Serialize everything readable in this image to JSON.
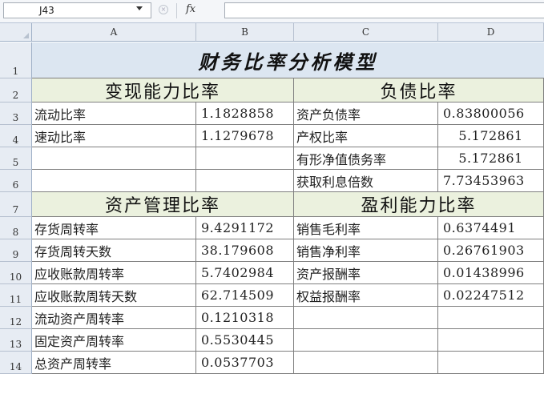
{
  "formula_bar": {
    "cell_ref": "J43",
    "fx": "fx",
    "cancel": "×"
  },
  "columns": [
    "A",
    "B",
    "C",
    "D"
  ],
  "rows": [
    "1",
    "2",
    "3",
    "4",
    "5",
    "6",
    "7",
    "8",
    "9",
    "10",
    "11",
    "12",
    "13",
    "14"
  ],
  "title": "财务比率分析模型",
  "sections": {
    "liquidity": "变现能力比率",
    "debt": "负债比率",
    "asset_mgmt": "资产管理比率",
    "profit": "盈利能力比率"
  },
  "liquidity_rows": [
    {
      "label": "流动比率",
      "value": "1.1828858"
    },
    {
      "label": "速动比率",
      "value": "1.1279678"
    }
  ],
  "debt_rows": [
    {
      "label": "资产负债率",
      "value": "0.83800056"
    },
    {
      "label": "产权比率",
      "value": "5.172861"
    },
    {
      "label": "有形净值债务率",
      "value": "5.172861"
    },
    {
      "label": "获取利息倍数",
      "value": "7.73453963"
    }
  ],
  "asset_rows": [
    {
      "label": "存货周转率",
      "value": "9.4291172"
    },
    {
      "label": "存货周转天数",
      "value": "38.179608"
    },
    {
      "label": "应收账款周转率",
      "value": "5.7402984"
    },
    {
      "label": "应收账款周转天数",
      "value": "62.714509"
    },
    {
      "label": "流动资产周转率",
      "value": "0.1210318"
    },
    {
      "label": "固定资产周转率",
      "value": "0.5530445"
    },
    {
      "label": "总资产周转率",
      "value": "0.0537703"
    }
  ],
  "profit_rows": [
    {
      "label": "销售毛利率",
      "value": "0.6374491"
    },
    {
      "label": "销售净利率",
      "value": "0.26761903"
    },
    {
      "label": "资产报酬率",
      "value": "0.01438996"
    },
    {
      "label": "权益报酬率",
      "value": "0.02247512"
    }
  ]
}
